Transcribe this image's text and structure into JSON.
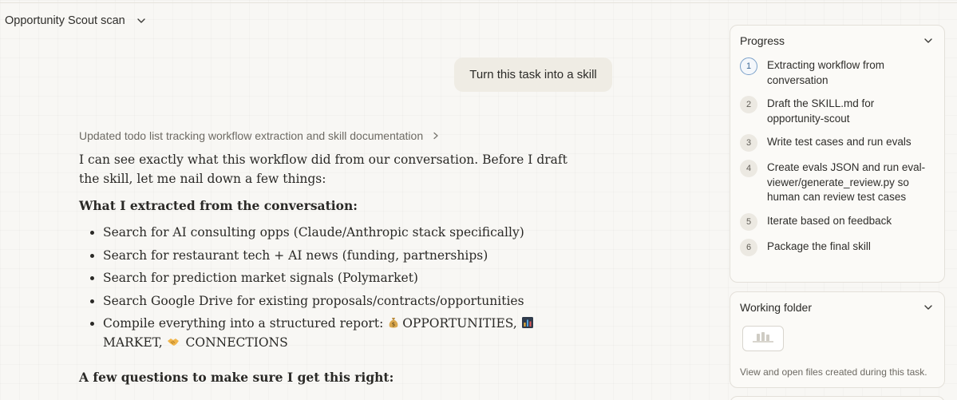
{
  "header": {
    "title": "Opportunity Scout scan"
  },
  "conversation": {
    "user_message": "Turn this task into a skill",
    "todo_summary": "Updated todo list tracking workflow extraction and skill documentation",
    "assistant": {
      "intro": "I can see exactly what this workflow did from our conversation. Before I draft the skill, let me nail down a few things:",
      "extracted_heading": "What I extracted from the conversation:",
      "items": [
        "Search for AI consulting opps (Claude/Anthropic stack specifically)",
        "Search for restaurant tech + AI news (funding, partnerships)",
        "Search for prediction market signals (Polymarket)",
        "Search Google Drive for existing proposals/contracts/opportunities"
      ],
      "compile": {
        "prefix": "Compile everything into a structured report: ",
        "opportunities": "OPPORTUNITIES,",
        "market": "MARKET,",
        "connections": "CONNECTIONS"
      },
      "questions_heading": "A few questions to make sure I get this right:"
    }
  },
  "progress": {
    "title": "Progress",
    "steps": [
      {
        "num": "1",
        "text": "Extracting workflow from conversation"
      },
      {
        "num": "2",
        "text": "Draft the SKILL.md for opportunity-scout"
      },
      {
        "num": "3",
        "text": "Write test cases and run evals"
      },
      {
        "num": "4",
        "text": "Create evals JSON and run eval-viewer/generate_review.py so human can review test cases"
      },
      {
        "num": "5",
        "text": "Iterate based on feedback"
      },
      {
        "num": "6",
        "text": "Package the final skill"
      }
    ]
  },
  "working_folder": {
    "title": "Working folder",
    "description": "View and open files created during this task."
  },
  "icons": {
    "title_dropdown": "chevron-down-icon",
    "todo_expand": "chevron-right-icon",
    "progress_collapse": "chevron-down-icon",
    "folder_collapse": "chevron-down-icon",
    "folder_preview": "file-stack-icon",
    "opportunities": "money-bag-icon",
    "market": "bar-chart-icon",
    "connections": "handshake-icon"
  },
  "colors": {
    "active_step_accent": "#7aa0c9",
    "user_bubble": "#efece4",
    "background": "#f8f7f4"
  }
}
